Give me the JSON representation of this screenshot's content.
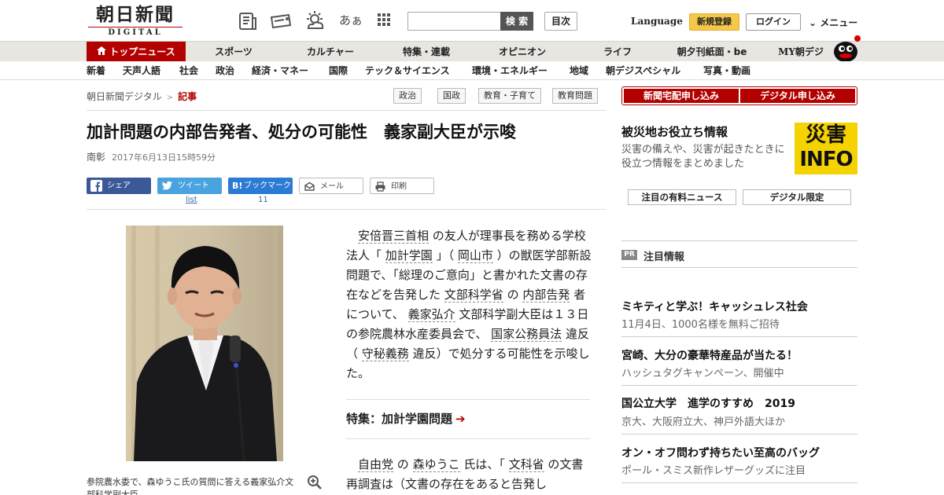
{
  "header": {
    "logo_main": "朝日新聞",
    "logo_sub": "DIGITAL",
    "search_placeholder": "",
    "search_label": "検 索",
    "mokuji_label": "目次",
    "language_label": "Language",
    "register_label": "新規登録",
    "login_label": "ログイン",
    "menu_label": "メニュー",
    "icons": [
      "newspaper-icon",
      "ticket-icon",
      "weather-icon",
      "font-size-icon",
      "grid-icon"
    ],
    "font_icon_text": "あぁ"
  },
  "nav_primary": [
    {
      "label": "トップニュース",
      "active": true
    },
    {
      "label": "スポーツ"
    },
    {
      "label": "カルチャー"
    },
    {
      "label": "特集・連載"
    },
    {
      "label": "オピニオン"
    },
    {
      "label": "ライフ"
    },
    {
      "label": "朝夕刊紙面・be"
    },
    {
      "label": "MY朝デジ"
    }
  ],
  "nav_secondary": [
    "新着",
    "天声人語",
    "社会",
    "政治",
    "経済・マネー",
    "国際",
    "テック＆サイエンス",
    "環境・エネルギー",
    "地域",
    "朝デジスペシャル",
    "写真・動画"
  ],
  "breadcrumb": {
    "home": "朝日新聞デジタル",
    "sep": ">",
    "current": "記事"
  },
  "tags": [
    "政治",
    "国政",
    "教育・子育て",
    "教育問題"
  ],
  "article": {
    "title": "加計問題の内部告発者、処分の可能性　義家副大臣が示唆",
    "author": "南彰",
    "date": "2017年6月13日15時59分",
    "share": {
      "facebook": "シェア",
      "twitter": "ツイート",
      "twitter_count": "list",
      "hatena": "ブックマーク",
      "hatena_count": "11",
      "mail": "メール",
      "print": "印刷"
    },
    "caption": "参院農水委で、森ゆうこ氏の質問に答える義家弘介文部科学副大臣",
    "paragraph1": [
      {
        "t": "安倍晋三首相",
        "l": true
      },
      {
        "t": " の友人が理事長を務める学校法人「 "
      },
      {
        "t": "加計学園",
        "l": true
      },
      {
        "t": " 」（ "
      },
      {
        "t": "岡山市",
        "l": true
      },
      {
        "t": " ）の獣医学部新設問題で、「総理のご意向」と書かれた文書の存在などを告発した "
      },
      {
        "t": "文部科学省",
        "l": true
      },
      {
        "t": " の "
      },
      {
        "t": "内部告発",
        "l": true
      },
      {
        "t": " 者について、 "
      },
      {
        "t": "義家弘介",
        "l": true
      },
      {
        "t": " 文部科学副大臣は１３日の参院農林水産委員会で、 "
      },
      {
        "t": "国家公務員法",
        "l": true
      },
      {
        "t": " 違反（ "
      },
      {
        "t": "守秘義務",
        "l": true
      },
      {
        "t": " 違反）で処分する可能性を示唆した。"
      }
    ],
    "feature_label": "特集：加計学園問題",
    "feature_arrow": "➔",
    "paragraph2": [
      {
        "t": "自由党",
        "l": true
      },
      {
        "t": " の "
      },
      {
        "t": "森ゆうこ",
        "l": true
      },
      {
        "t": " 氏は、「 "
      },
      {
        "t": "文科省",
        "l": true
      },
      {
        "t": " の文書再調査は（文書の存在をあると告発し"
      }
    ]
  },
  "sidebar": {
    "promo_delivery": "新聞宅配申し込み",
    "promo_digital": "デジタル申し込み",
    "disaster_title": "被災地お役立ち情報",
    "disaster_desc": "災害の備えや、災害が起きたときに役立つ情報をまとめました",
    "disaster_logo_top": "災害",
    "disaster_logo_bottom": "INFO",
    "btn_paid_news": "注目の有料ニュース",
    "btn_digital_only": "デジタル限定",
    "pr_badge": "PR",
    "pr_title": "注目情報",
    "ads": [
      {
        "title": "ミキティと学ぶ！キャッシュレス社会",
        "sub": "11月4日、1000名様を無料ご招待"
      },
      {
        "title": "宮崎、大分の豪華特産品が当たる！",
        "sub": "ハッシュタグキャンペーン、開催中"
      },
      {
        "title": "国公立大学　進学のすすめ　2019",
        "sub": "京大、大阪府立大、神戸外語大ほか"
      },
      {
        "title": "オン・オフ問わず持ちたい至高のバッグ",
        "sub": "ポール・スミス新作レザーグッズに注目"
      }
    ]
  },
  "colors": {
    "brand_red": "#b30000",
    "nav_bg": "#e8e6e1",
    "register_yellow": "#f5c84a",
    "disaster_yellow": "#f5d300"
  }
}
